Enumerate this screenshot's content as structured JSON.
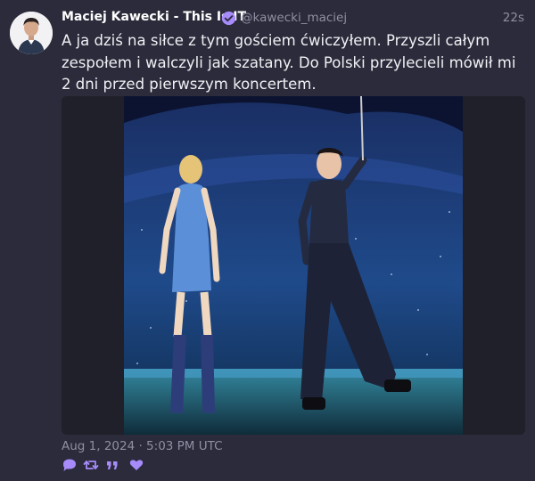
{
  "post": {
    "author_name": "Maciej Kawecki - This Is IT",
    "handle": "@kawecki_maciej",
    "relative_time": "22s",
    "text": "A ja dziś na siłce z tym gościem ćwiczyłem. Przyszli całym zespołem i walczyli jak szatany. Do Polski przylecieli mówił mi 2 dni przed pierwszym koncertem.",
    "timestamp": "Aug 1, 2024 · 5:03 PM UTC"
  },
  "icons": {
    "verified": "verified-badge-icon",
    "reply": "speech-bubble-icon",
    "repost": "retweet-icon",
    "quote": "quote-icon",
    "like": "heart-icon"
  },
  "colors": {
    "background": "#2b2b3b",
    "accent": "#a78bfa",
    "muted_text": "#8f8fa3",
    "name_text": "#ffffff"
  }
}
